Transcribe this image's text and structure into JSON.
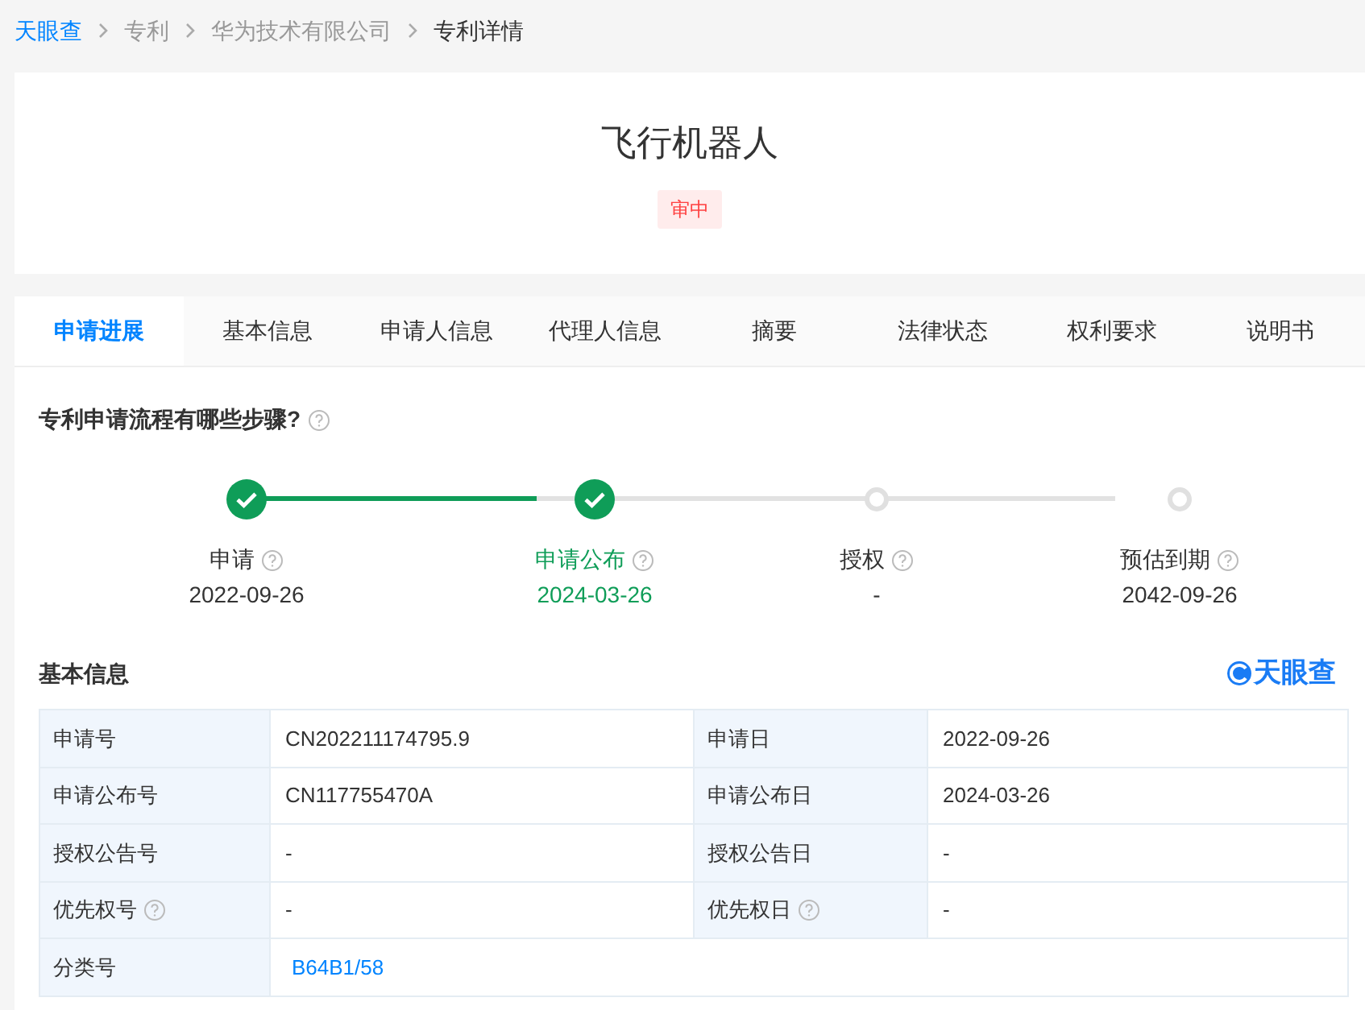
{
  "breadcrumb": [
    {
      "label": "天眼查",
      "kind": "link"
    },
    {
      "label": "专利",
      "kind": "crumb"
    },
    {
      "label": "华为技术有限公司",
      "kind": "crumb"
    },
    {
      "label": "专利详情",
      "kind": "current"
    }
  ],
  "header": {
    "title": "飞行机器人",
    "status": "审中"
  },
  "tabs": [
    {
      "label": "申请进展",
      "selected": true
    },
    {
      "label": "基本信息",
      "selected": false
    },
    {
      "label": "申请人信息",
      "selected": false
    },
    {
      "label": "代理人信息",
      "selected": false
    },
    {
      "label": "摘要",
      "selected": false
    },
    {
      "label": "法律状态",
      "selected": false
    },
    {
      "label": "权利要求",
      "selected": false
    },
    {
      "label": "说明书",
      "selected": false
    }
  ],
  "progress": {
    "title": "专利申请流程有哪些步骤?",
    "steps": [
      {
        "label": "申请",
        "date": "2022-09-26",
        "done": true,
        "current": false
      },
      {
        "label": "申请公布",
        "date": "2024-03-26",
        "done": true,
        "current": true
      },
      {
        "label": "授权",
        "date": "-",
        "done": false,
        "current": false
      },
      {
        "label": "预估到期",
        "date": "2042-09-26",
        "done": false,
        "current": false
      }
    ]
  },
  "basic_info": {
    "title": "基本信息",
    "logo": "天眼查",
    "rows": [
      [
        {
          "label": "申请号",
          "value": "CN202211174795.9",
          "help": false
        },
        {
          "label": "申请日",
          "value": "2022-09-26",
          "help": false
        }
      ],
      [
        {
          "label": "申请公布号",
          "value": "CN117755470A",
          "help": false
        },
        {
          "label": "申请公布日",
          "value": "2024-03-26",
          "help": false
        }
      ],
      [
        {
          "label": "授权公告号",
          "value": "-",
          "help": false
        },
        {
          "label": "授权公告日",
          "value": "-",
          "help": false
        }
      ],
      [
        {
          "label": "优先权号",
          "value": "-",
          "help": true
        },
        {
          "label": "优先权日",
          "value": "-",
          "help": true
        }
      ],
      [
        {
          "label": "分类号",
          "value": "B64B1/58",
          "help": false,
          "kind": "link"
        }
      ]
    ]
  }
}
